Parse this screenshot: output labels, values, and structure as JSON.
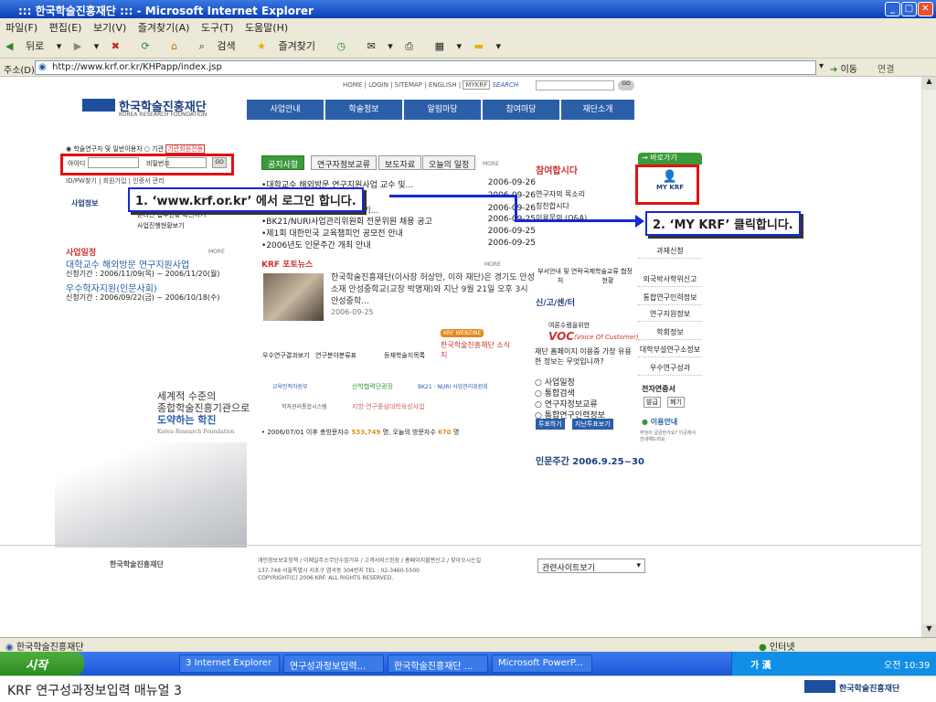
{
  "window": {
    "title": "::: 한국학술진흥재단 ::: - Microsoft Internet Explorer"
  },
  "menu": [
    "파일(F)",
    "편집(E)",
    "보기(V)",
    "즐겨찾기(A)",
    "도구(T)",
    "도움말(H)"
  ],
  "toolbar": {
    "back": "뒤로",
    "search": "검색",
    "favorites": "즐겨찾기"
  },
  "address": {
    "label": "주소(D)",
    "url": "http://www.krf.or.kr/KHPapp/index.jsp",
    "go": "이동",
    "links": "연결"
  },
  "site": {
    "logo_ko": "한국학술진흥재단",
    "logo_en": "KOREA RESEARCH FOUNDATION",
    "top_links": [
      "HOME",
      "LOGIN",
      "SITEMAP",
      "ENGLISH",
      "MYKRF",
      "SEARCH"
    ],
    "nav": [
      {
        "en": "Program",
        "ko": "사업안내"
      },
      {
        "en": "Database",
        "ko": "학술정보"
      },
      {
        "en": "Notice",
        "ko": "알림마당"
      },
      {
        "en": "C/S Center",
        "ko": "참여마당"
      },
      {
        "en": "Information",
        "ko": "재단소개"
      }
    ],
    "login": {
      "type_researcher": "학술연구자 및 일반이용자",
      "type_org": "기관",
      "org_login": "기관회원전용",
      "id_label": "아이디",
      "pw_label": "비밀번호",
      "go": "GO",
      "find": "ID/PW찾기",
      "join": "회원가입",
      "cert": "인증서 관리"
    },
    "biz_info_title": "사업정보",
    "biz_info_items": [
      "온라인 접수현황 확인하기",
      "사업진행현황보기"
    ],
    "biz_schedule_title": "사업일정",
    "more": "MORE",
    "schedule": [
      {
        "title": "대학교수 해외방문 연구지원사업",
        "period": "신청기간 : 2006/11/09(목) ~ 2006/11/20(월)"
      },
      {
        "title": "우수학자지원(인문사회)",
        "period": "신청기간 : 2006/09/22(금) ~ 2006/10/18(수)"
      }
    ],
    "tabs": [
      "공지사항",
      "연구자정보교류",
      "보도자료",
      "오늘의 일정"
    ],
    "news": [
      {
        "title": "•대학교수 해외방문 연구지원사업 교수 및...",
        "date": "2006-09-26"
      },
      {
        "title": "•",
        "date": "2006-09-26"
      },
      {
        "title": "•2006년 인문주간 행사 참여기...",
        "date": "2006-09-26"
      },
      {
        "title": "•BK21/NURI사업관리위원회 전문위원 채용 공고",
        "date": "2006-09-25"
      },
      {
        "title": "•제1회 대한민국 교육챔피언 공모전 안내",
        "date": "2006-09-25"
      },
      {
        "title": "•2006년도 인문주간 개최 안내",
        "date": "2006-09-25"
      }
    ],
    "photo_news_title": "KRF 포토뉴스",
    "photo_news_text": "한국학술진흥재단(이사장 허상만, 이하 재단)은 경기도 안성 소재 안성중학교(교장 박명재)와 지난 9월 21일 오후 3시 안성중학...",
    "photo_news_date": "2006-09-25",
    "quick_buttons": [
      "우수연구결과보기",
      "연구분야분류표",
      "등재학술지목록"
    ],
    "webzine_tag": "KRF WEBZINE",
    "webzine_title": "한국학술진흥재단 소식지",
    "slogan": [
      "세계적 수준의",
      "종합학술진흥기관으로",
      "도약하는 학진"
    ],
    "slogan_en": "Korea Research Foundation",
    "partners": [
      "교육인적자원부",
      "산학협력단광장",
      "BK21 · NURI 사업관리위원회",
      "학자관리통합시스템",
      "지방·연구중심대학육성사업"
    ],
    "visitors": {
      "prefix": "• 2006/07/01 이후 총방문자수",
      "total": "533,749",
      "mid": "명, 오늘의 방문자수",
      "today": "670",
      "suffix": "명"
    },
    "participate": {
      "title": "참여합시다",
      "items": [
        "연구자의 목소리",
        "칭찬합시다",
        "이용문의 (Q&A)"
      ]
    },
    "icons": [
      "부서안내 및 연락처",
      "국제학술교류 협정현황"
    ],
    "sinmun": "신/고/센/터",
    "voc": {
      "head": "여론수렴을위한",
      "title": "VOC",
      "sub": "(Voice Of Customer)",
      "question": "재단 홈페이지 이용중 가장 유용한 정보는 무엇입니까?",
      "options": [
        "사업일정",
        "통합검색",
        "연구자정보교류",
        "통합연구인력정보"
      ],
      "vote": "투표하기",
      "results": "지난투표보기"
    },
    "humanities": {
      "label": "인문주간",
      "dates": "2006.9.25~30"
    },
    "sidebar": {
      "header": "바로가기",
      "mykrf": "MY KRF",
      "items": [
        "과제신청",
        "외국박사학위신고",
        "통합연구인력정보",
        "연구지원정보",
        "학회정보",
        "대학부설연구소정보",
        "우수연구성과"
      ],
      "cert": "전자연증서",
      "cert_links": [
        "발급",
        "폐기"
      ],
      "guide": "이용안내",
      "guide_text": "무엇이 궁금한가요? 이곳에서 안내해드려요"
    },
    "footer": {
      "links": "개인정보보호정책 / 이메일주소무단수집거부 / 고객서비스헌장 / 홈페이지불편신고 / 찾아오시는길",
      "address": "137-748 서울특별시 서초구 염곡동 304번지 TEL : 02-3460-5500",
      "copyright": "COPYRIGHT(C) 2006 KRF. ALL RIGHTS RESERVED.",
      "related": "관련사이트보기"
    }
  },
  "callouts": {
    "step1": "1. ‘www.krf.or.kr’ 에서 로그인 합니다.",
    "step2": "2. ‘MY KRF’ 클릭합니다."
  },
  "status": {
    "left": "한국학술진흥재단",
    "zone": "인터넷"
  },
  "taskbar": {
    "start": "시작",
    "tasks": [
      "3 Internet Explorer",
      "연구성과정보입력...",
      "한국학술진흥재단 ...",
      "Microsoft PowerP..."
    ],
    "clock": "오전 10:39",
    "ime": "가 漢"
  },
  "caption": "KRF 연구성과정보입력 매뉴얼 3",
  "colors": {
    "highlight_red": "#e31010",
    "callout_blue": "#1428d8",
    "nav_blue": "#2b5fa8",
    "green_tab": "#3a9a3a"
  }
}
